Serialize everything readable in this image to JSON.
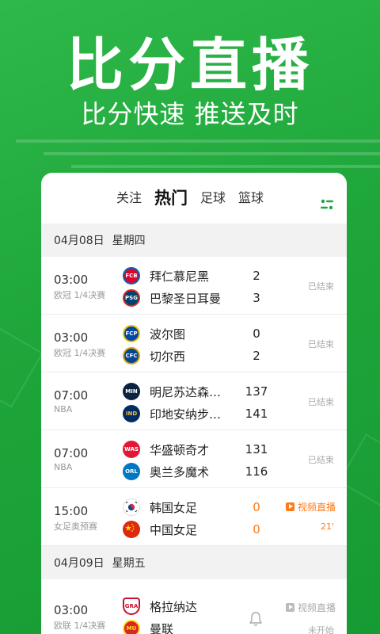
{
  "hero": {
    "title": "比分直播",
    "subtitle": "比分快速 推送及时"
  },
  "tabs": [
    {
      "label": "关注"
    },
    {
      "label": "热门"
    },
    {
      "label": "足球"
    },
    {
      "label": "篮球"
    }
  ],
  "days": [
    {
      "date": "04月08日",
      "weekday": "星期四",
      "matches": [
        {
          "time": "03:00",
          "league": "欧冠 1/4决赛",
          "home": "拜仁慕尼黑",
          "away": "巴黎圣日耳曼",
          "home_score": "2",
          "away_score": "3",
          "status": "已结束",
          "home_logo": "FCB",
          "away_logo": "PSG"
        },
        {
          "time": "03:00",
          "league": "欧冠 1/4决赛",
          "home": "波尔图",
          "away": "切尔西",
          "home_score": "0",
          "away_score": "2",
          "status": "已结束",
          "home_logo": "FCP",
          "away_logo": "CFC"
        },
        {
          "time": "07:00",
          "league": "NBA",
          "home": "明尼苏达森林狼",
          "away": "印地安纳步行者",
          "home_score": "137",
          "away_score": "141",
          "status": "已结束",
          "home_logo": "MIN",
          "away_logo": "IND"
        },
        {
          "time": "07:00",
          "league": "NBA",
          "home": "华盛顿奇才",
          "away": "奥兰多魔术",
          "home_score": "131",
          "away_score": "116",
          "status": "已结束",
          "home_logo": "WAS",
          "away_logo": "ORL"
        },
        {
          "time": "15:00",
          "league": "女足奥预赛",
          "home": "韩国女足",
          "away": "中国女足",
          "home_score": "0",
          "away_score": "0",
          "live_label": "视频直播",
          "minute": "21'",
          "home_logo": "KOR",
          "away_logo": "CHN"
        }
      ]
    },
    {
      "date": "04月09日",
      "weekday": "星期五",
      "matches": [
        {
          "time": "03:00",
          "league": "欧联 1/4决赛",
          "home": "格拉纳达",
          "away": "曼联",
          "live_label": "视频直播",
          "status": "未开始",
          "home_logo": "GRA",
          "away_logo": "MU"
        }
      ]
    }
  ],
  "colors": {
    "brand_green": "#1ea63a",
    "live_orange": "#ff7a1a"
  }
}
